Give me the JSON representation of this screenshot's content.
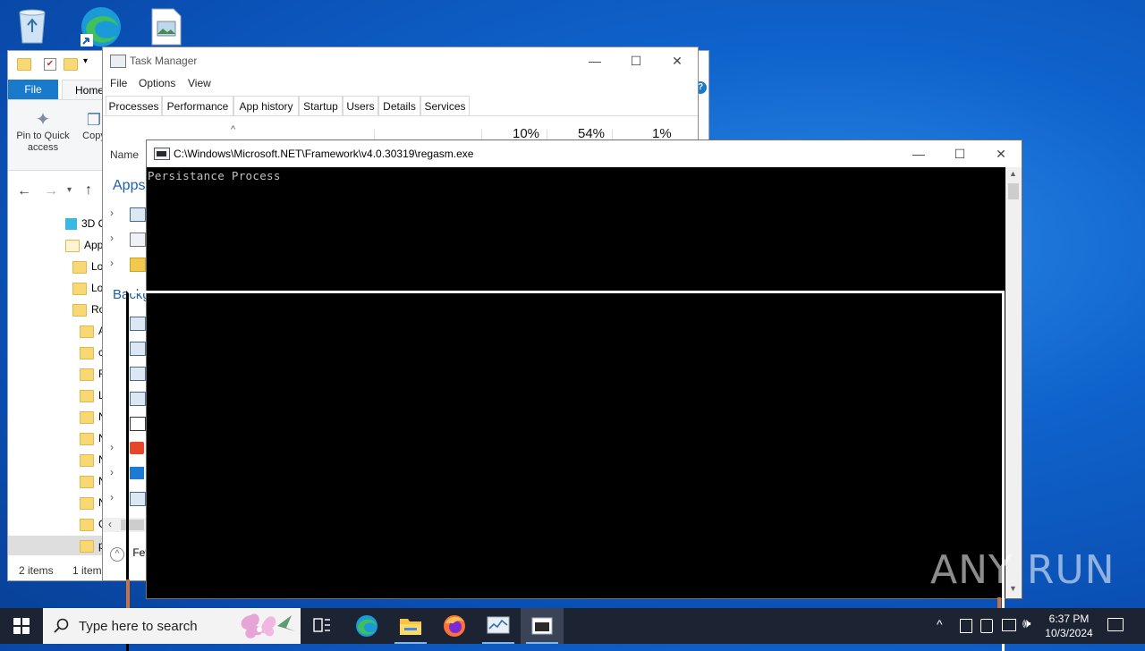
{
  "explorer": {
    "tabs": {
      "file": "File",
      "home": "Home"
    },
    "ribbon": {
      "pin": "Pin to Quick access",
      "copy": "Copy"
    },
    "tree": [
      {
        "label": "3D O"
      },
      {
        "label": "App"
      },
      {
        "label": "Lo"
      },
      {
        "label": "Lo"
      },
      {
        "label": "Ro"
      },
      {
        "label": "A"
      },
      {
        "label": "c"
      },
      {
        "label": "F"
      },
      {
        "label": "L"
      },
      {
        "label": "N"
      },
      {
        "label": "N"
      },
      {
        "label": "N"
      },
      {
        "label": "N"
      },
      {
        "label": "N"
      },
      {
        "label": "C"
      },
      {
        "label": "p"
      }
    ],
    "status": {
      "items": "2 items",
      "selected": "1 item"
    }
  },
  "taskmgr": {
    "title": "Task Manager",
    "menu": [
      "File",
      "Options",
      "View"
    ],
    "tabs": [
      "Processes",
      "Performance",
      "App history",
      "Startup",
      "Users",
      "Details",
      "Services"
    ],
    "columns": {
      "name": "Name",
      "cpu": "10%",
      "memory": "54%",
      "disk": "1%"
    },
    "groups": {
      "apps": "Apps",
      "background": "Backg"
    },
    "footer": "Fev"
  },
  "console": {
    "title": "C:\\Windows\\Microsoft.NET\\Framework\\v4.0.30319\\regasm.exe",
    "output": "Persistance Process"
  },
  "taskbar": {
    "search_placeholder": "Type here to search",
    "time": "6:37 PM",
    "date": "10/3/2024"
  },
  "watermark": "ANY RUN",
  "colors": {
    "accent": "#1979ca",
    "taskbar": "#1c2333",
    "console_bg": "#000000"
  }
}
